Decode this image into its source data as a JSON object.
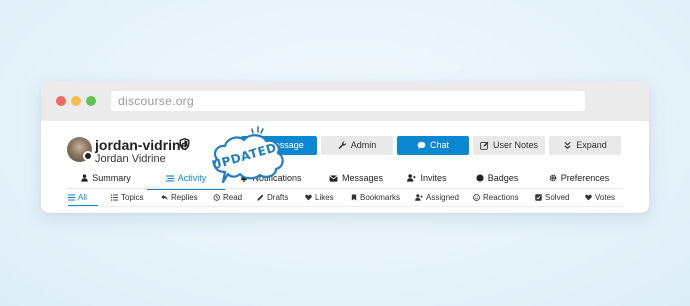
{
  "browser": {
    "url": "discourse.org"
  },
  "profile": {
    "username": "jordan-vidrine",
    "full_name": "Jordan Vidrine"
  },
  "actions": {
    "message": "Message",
    "admin": "Admin",
    "chat": "Chat",
    "user_notes": "User Notes",
    "expand": "Expand"
  },
  "nav_tabs": [
    {
      "label": "Summary",
      "icon": "user-icon"
    },
    {
      "label": "Activity",
      "icon": "stream-icon",
      "active": true
    },
    {
      "label": "Notifications",
      "icon": "bell-icon"
    },
    {
      "label": "Messages",
      "icon": "envelope-icon"
    },
    {
      "label": "Invites",
      "icon": "user-plus-icon"
    },
    {
      "label": "Badges",
      "icon": "certificate-icon"
    },
    {
      "label": "Preferences",
      "icon": "cog-icon"
    }
  ],
  "activity_tabs": [
    {
      "label": "All",
      "icon": "list-icon",
      "active": true
    },
    {
      "label": "Topics",
      "icon": "list-ul-icon"
    },
    {
      "label": "Replies",
      "icon": "reply-icon"
    },
    {
      "label": "Read",
      "icon": "history-icon"
    },
    {
      "label": "Drafts",
      "icon": "pencil-icon"
    },
    {
      "label": "Likes",
      "icon": "heart-icon"
    },
    {
      "label": "Bookmarks",
      "icon": "bookmark-icon"
    },
    {
      "label": "Assigned",
      "icon": "user-plus-icon"
    },
    {
      "label": "Reactions",
      "icon": "smile-icon"
    },
    {
      "label": "Solved",
      "icon": "check-square-icon"
    },
    {
      "label": "Votes",
      "icon": "heart-icon"
    }
  ],
  "overlay_badge": {
    "text": "UPDATED"
  },
  "colors": {
    "accent": "#0c88d3",
    "badge_text": "#1f7fc1"
  }
}
